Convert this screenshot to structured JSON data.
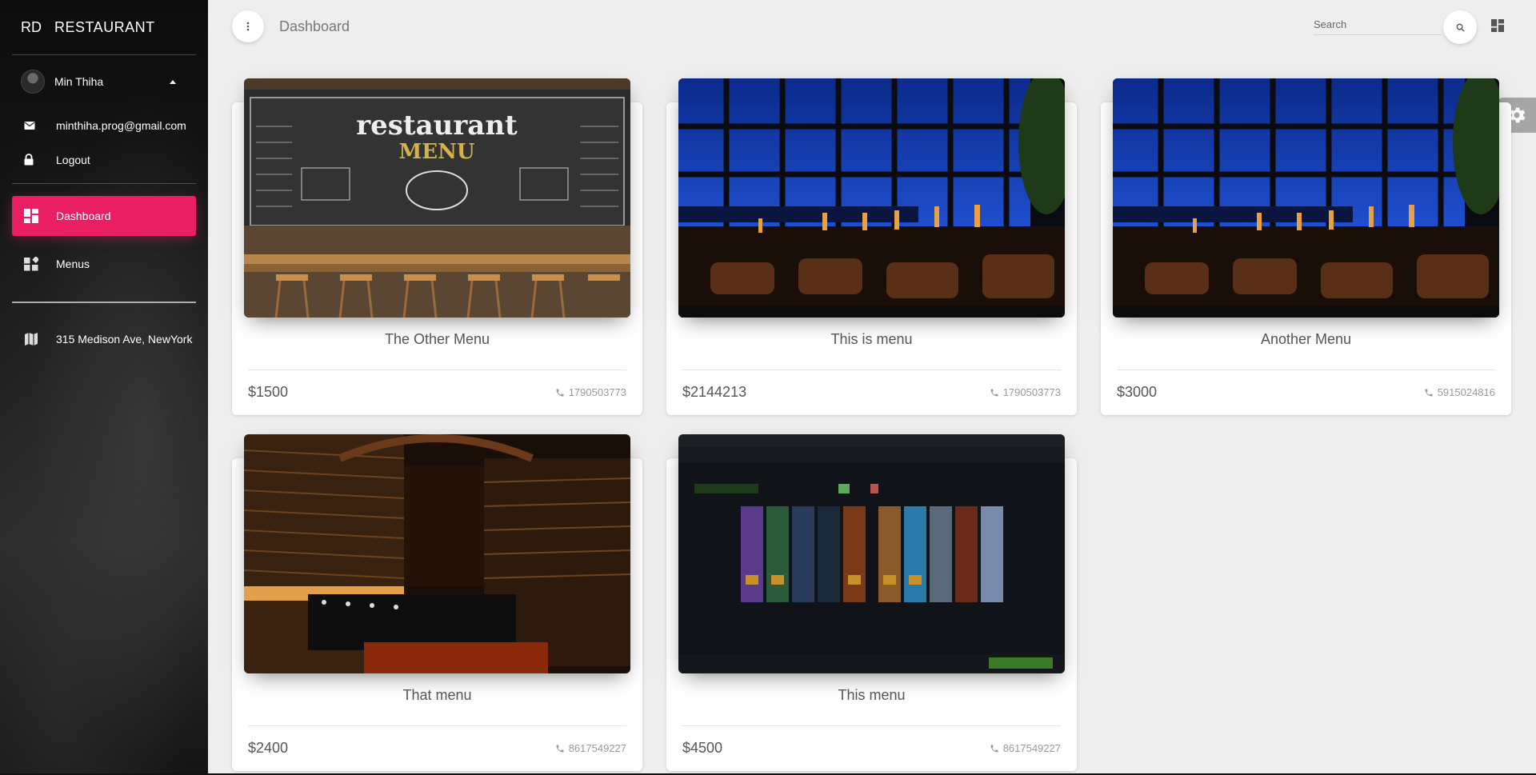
{
  "sidebar": {
    "brand_mini": "RD",
    "brand_full": "RESTAURANT",
    "user_name": "Min Thiha",
    "email": "minthiha.prog@gmail.com",
    "logout": "Logout",
    "nav": [
      {
        "label": "Dashboard",
        "icon": "dashboard-icon",
        "active": true
      },
      {
        "label": "Menus",
        "icon": "widgets-icon",
        "active": false
      }
    ],
    "address": "315 Medison Ave, NewYork"
  },
  "header": {
    "title": "Dashboard",
    "search_placeholder": "Search"
  },
  "cards": [
    {
      "title": "The Other Menu",
      "price": "$1500",
      "phone": "1790503773",
      "image": "chalkboard-menu"
    },
    {
      "title": "This is menu",
      "price": "$2144213",
      "phone": "1790503773",
      "image": "night-restaurant"
    },
    {
      "title": "Another Menu",
      "price": "$3000",
      "phone": "5915024816",
      "image": "night-restaurant"
    },
    {
      "title": "That menu",
      "price": "$2400",
      "phone": "8617549227",
      "image": "wine-cellar"
    },
    {
      "title": "This menu",
      "price": "$4500",
      "phone": "8617549227",
      "image": "game-screenshot"
    }
  ],
  "colors": {
    "accent": "#e91e63",
    "background": "#eeeeee",
    "sidebar": "#1a1a1a"
  }
}
